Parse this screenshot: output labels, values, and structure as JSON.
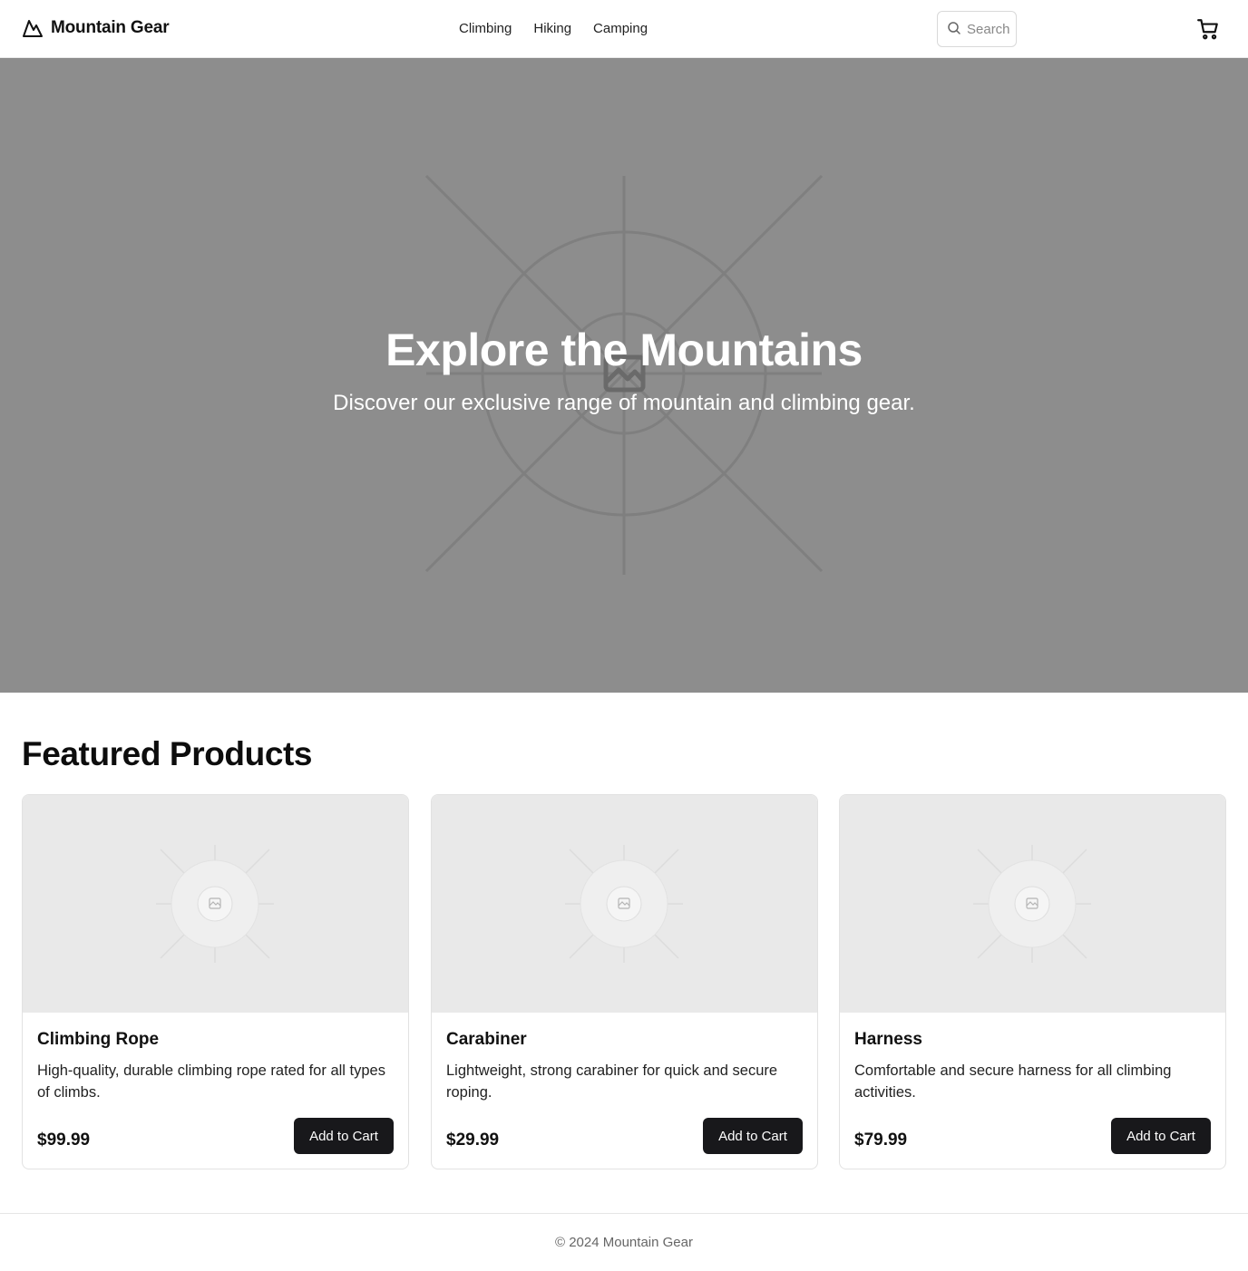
{
  "header": {
    "brand": "Mountain Gear",
    "logo_icon": "mountain-icon",
    "nav": [
      "Climbing",
      "Hiking",
      "Camping"
    ],
    "search_placeholder": "Search",
    "cart_icon": "shopping-cart-icon"
  },
  "hero": {
    "title": "Explore the Mountains",
    "subtitle": "Discover our exclusive range of mountain and climbing gear.",
    "image_icon": "image-placeholder-icon"
  },
  "featured": {
    "title": "Featured Products",
    "products": [
      {
        "name": "Climbing Rope",
        "description": "High-quality, durable climbing rope rated for all types of climbs.",
        "price": "$99.99",
        "button": "Add to Cart"
      },
      {
        "name": "Carabiner",
        "description": "Lightweight, strong carabiner for quick and secure roping.",
        "price": "$29.99",
        "button": "Add to Cart"
      },
      {
        "name": "Harness",
        "description": "Comfortable and secure harness for all climbing activities.",
        "price": "$79.99",
        "button": "Add to Cart"
      }
    ]
  },
  "footer": {
    "text": "© 2024 Mountain Gear"
  },
  "colors": {
    "hero_bg": "#8d8d8d",
    "button_bg": "#18181b",
    "placeholder_bg": "#e9e9e9"
  }
}
